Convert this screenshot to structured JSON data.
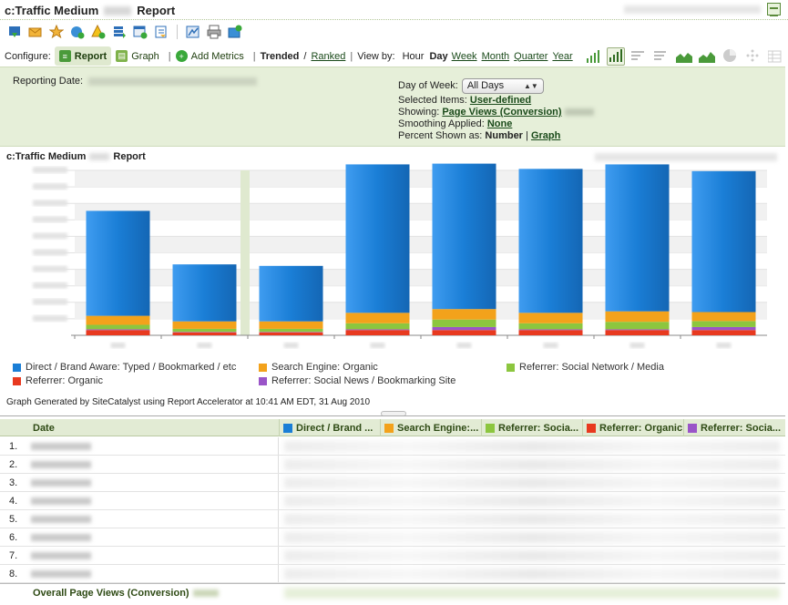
{
  "title": {
    "prefix": "c:Traffic Medium",
    "suffix": "Report"
  },
  "toolbar": {
    "icons": [
      "download-icon",
      "email-icon",
      "bookmark-icon",
      "add-dashboard-icon",
      "alert-icon",
      "data-extract-icon",
      "schedule-icon",
      "export-icon",
      "excel-icon",
      "print-icon",
      "add-to-dashboard-icon"
    ]
  },
  "config": {
    "label": "Configure:",
    "report_label": "Report",
    "graph_label": "Graph",
    "add_metrics_label": "Add Metrics",
    "trended_label": "Trended",
    "slash": "/",
    "ranked_label": "Ranked",
    "viewby_label": "View by:",
    "periods": [
      "Hour",
      "Day",
      "Week",
      "Month",
      "Quarter",
      "Year"
    ],
    "selected_period": "Day"
  },
  "settings": {
    "reporting_date_label": "Reporting Date:",
    "day_of_week_label": "Day of Week:",
    "day_of_week_value": "All Days",
    "selected_items_label": "Selected Items:",
    "selected_items_value": "User-defined",
    "showing_label": "Showing:",
    "showing_value": "Page Views (Conversion)",
    "smoothing_label": "Smoothing Applied:",
    "smoothing_value": "None",
    "percent_label": "Percent Shown as:",
    "percent_number": "Number",
    "percent_sep": "|",
    "percent_graph": "Graph"
  },
  "chart_header": {
    "title_prefix": "c:Traffic Medium",
    "title_suffix": "Report"
  },
  "chart_data": {
    "type": "bar",
    "stacked": true,
    "categories": [
      "1",
      "2",
      "3",
      "4",
      "5",
      "6",
      "7",
      "8"
    ],
    "series": [
      {
        "name": "Referrer: Organic",
        "color": "#e8391f",
        "values": [
          0.035,
          0.02,
          0.02,
          0.035,
          0.035,
          0.035,
          0.035,
          0.035
        ]
      },
      {
        "name": "Referrer: Social News / Bookmarking Site",
        "color": "#9a55c8",
        "values": [
          0.005,
          0.003,
          0.003,
          0.005,
          0.02,
          0.005,
          0.005,
          0.02
        ]
      },
      {
        "name": "Referrer: Social Network / Media",
        "color": "#8cc63f",
        "values": [
          0.03,
          0.02,
          0.02,
          0.04,
          0.05,
          0.04,
          0.05,
          0.04
        ]
      },
      {
        "name": "Search Engine: Organic",
        "color": "#f3a21b",
        "values": [
          0.06,
          0.05,
          0.05,
          0.07,
          0.07,
          0.07,
          0.07,
          0.06
        ]
      },
      {
        "name": "Direct / Brand Aware: Typed / Bookmarked / etc",
        "color": "#1a7ed6",
        "values": [
          0.7,
          0.38,
          0.37,
          0.99,
          0.97,
          0.96,
          0.98,
          0.94
        ]
      }
    ],
    "ylim": [
      0,
      1.1
    ],
    "highlight_category_index": 2,
    "grid": true
  },
  "legend": {
    "items": [
      {
        "label": "Direct / Brand Aware: Typed / Bookmarked / etc",
        "color": "#1a7ed6"
      },
      {
        "label": "Search Engine: Organic",
        "color": "#f3a21b"
      },
      {
        "label": "Referrer: Social Network / Media",
        "color": "#8cc63f"
      },
      {
        "label": "Referrer: Organic",
        "color": "#e8391f"
      },
      {
        "label": "Referrer: Social News / Bookmarking Site",
        "color": "#9a55c8"
      }
    ]
  },
  "generated_text": "Graph Generated by SiteCatalyst using Report Accelerator at 10:41 AM EDT, 31 Aug 2010",
  "table": {
    "date_header": "Date",
    "columns": [
      {
        "label": "Direct / Brand ...",
        "color": "#1a7ed6"
      },
      {
        "label": "Search Engine:...",
        "color": "#f3a21b"
      },
      {
        "label": "Referrer: Socia...",
        "color": "#8cc63f"
      },
      {
        "label": "Referrer: Organic",
        "color": "#e8391f"
      },
      {
        "label": "Referrer: Socia...",
        "color": "#9a55c8"
      }
    ],
    "row_numbers": [
      "1.",
      "2.",
      "3.",
      "4.",
      "5.",
      "6.",
      "7.",
      "8."
    ],
    "total_label": "Overall Page Views (Conversion)"
  }
}
